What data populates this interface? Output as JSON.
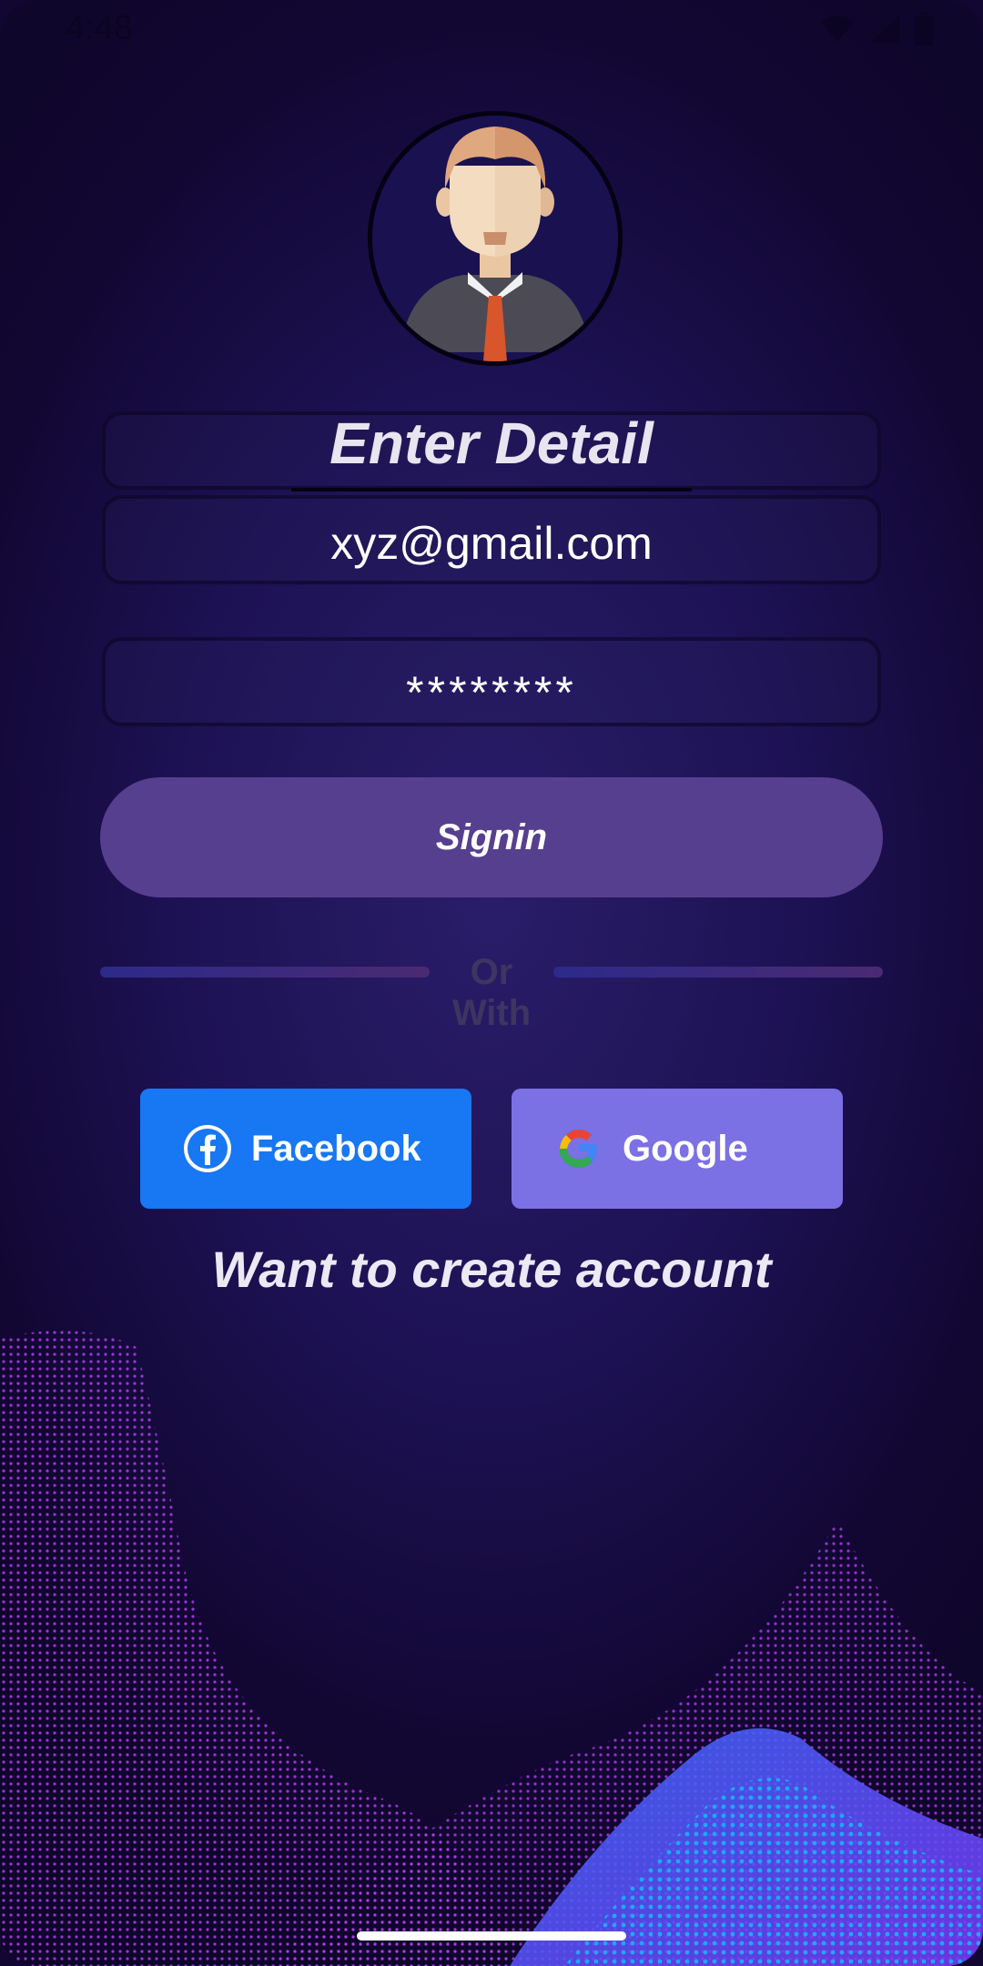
{
  "status_bar": {
    "time": "4:48"
  },
  "form": {
    "title": "Enter Detail",
    "email_value": "xyz@gmail.com",
    "password_value": "********"
  },
  "buttons": {
    "signin_label": "Signin",
    "divider_label": "Or With",
    "facebook_label": "Facebook",
    "google_label": "Google"
  },
  "links": {
    "create_account": "Want to create account"
  },
  "colors": {
    "background": "#1d1254",
    "signin": "#573f8f",
    "facebook": "#1877f2",
    "google": "#7b70e4",
    "wave_magenta": "#b23df0",
    "wave_blue": "#1fa6ff"
  },
  "icons": [
    "wifi-icon",
    "signal-icon",
    "battery-icon",
    "avatar-icon",
    "facebook-icon",
    "google-icon"
  ]
}
